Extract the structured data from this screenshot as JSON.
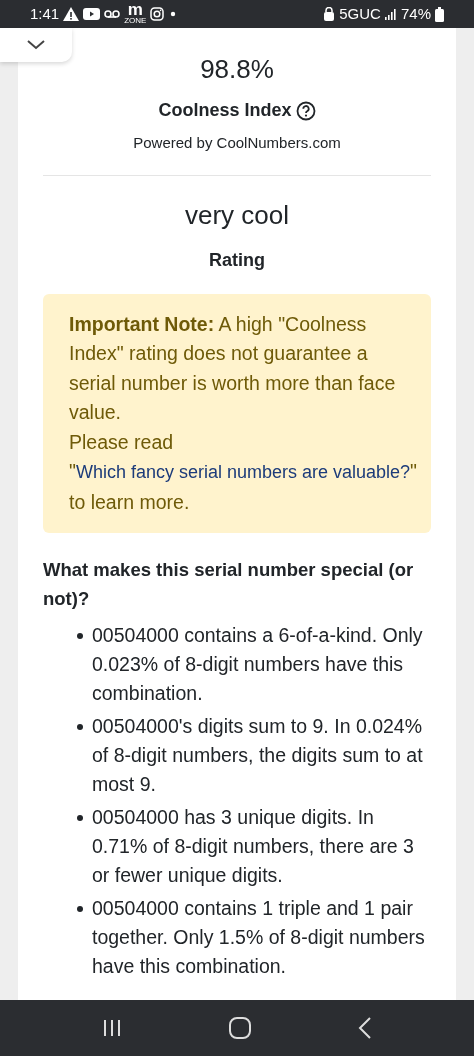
{
  "status_bar": {
    "time": "1:41",
    "logo_mark": "m",
    "logo_caption": "ZONE",
    "network": "5GUC",
    "battery": "74%"
  },
  "score": {
    "value": "98.8%",
    "label": "Coolness Index",
    "powered_by": "Powered by CoolNumbers.com"
  },
  "rating": {
    "value": "very cool",
    "label": "Rating"
  },
  "note": {
    "text": "**Important Note:** A high \"Coolness Index\" rating does not guarantee a serial number is worth more than face value.",
    "read_before": "Please read \"",
    "link": "Which fancy serial numbers are valuable?",
    "read_after": "\" to learn more."
  },
  "special": {
    "heading": "What makes this serial number special (or not)?",
    "items": [
      "00504000 contains a 6-of-a-kind. Only 0.023% of 8-digit numbers have this combination.",
      "00504000's digits sum to 9. In 0.024% of 8-digit numbers, the digits sum to at most 9.",
      "00504000 has 3 unique digits. In 0.71% of 8-digit numbers, there are 3 or fewer unique digits.",
      "00504000 contains 1 triple and 1 pair together. Only 1.5% of 8-digit numbers have this combination."
    ]
  }
}
